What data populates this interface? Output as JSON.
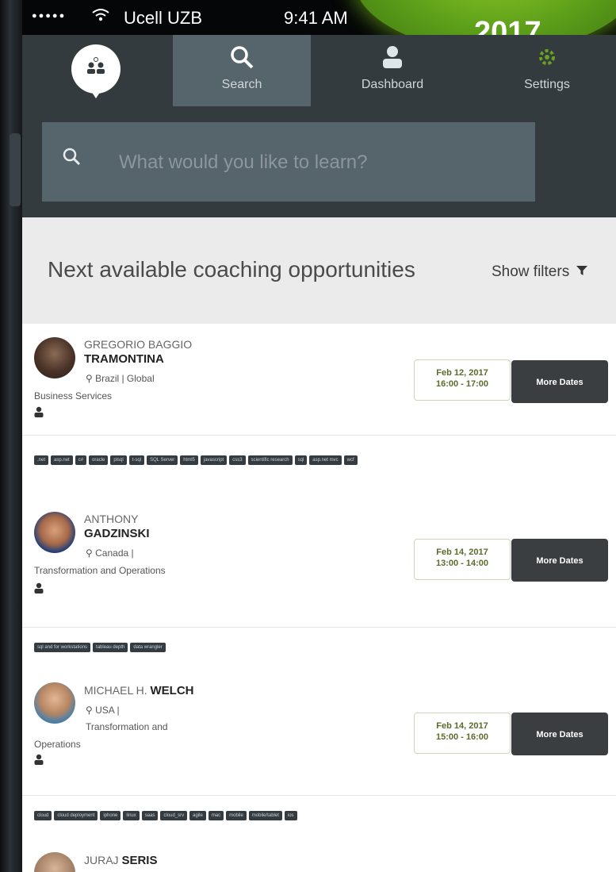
{
  "status_bar": {
    "signal": "●●●●●",
    "wifi_icon": "wifi-icon",
    "carrier": "Ucell UZB",
    "time": "9:41 AM"
  },
  "badge": {
    "text": "2017"
  },
  "nav": {
    "tabs": [
      {
        "label": "Search",
        "icon": "search-icon",
        "active": true
      },
      {
        "label": "Dashboard",
        "icon": "person-icon",
        "active": false
      },
      {
        "label": "Settings",
        "icon": "gear-icon",
        "active": false
      }
    ]
  },
  "search": {
    "placeholder": "What would you like to learn?"
  },
  "section": {
    "title": "Next available coaching opportunities",
    "filters_label": "Show filters"
  },
  "coaches": [
    {
      "first_name": "GREGORIO BAGGIO",
      "last_name": "TRAMONTINA",
      "location": "Brazil | Global",
      "role": "Business Services",
      "date": "Feb 12, 2017",
      "time": "16:00 - 17:00",
      "more_label": "More Dates",
      "tags": [
        ".net",
        "asp.net",
        "c#",
        "oracle",
        "plsql",
        "t-sql",
        "SQL Server",
        "html5",
        "javascript",
        "css3",
        "scientific research",
        "sql",
        "asp.net mvc",
        "wcf"
      ]
    },
    {
      "first_name": "ANTHONY",
      "last_name": "GADZINSKI",
      "location": "Canada |",
      "role": "Transformation and Operations",
      "date": "Feb 14, 2017",
      "time": "13:00 - 14:00",
      "more_label": "More Dates",
      "tags": [
        "sql and for workstations",
        "tableau depth",
        "data wrangler"
      ]
    },
    {
      "first_name": "MICHAEL H.",
      "last_name": "WELCH",
      "location": "USA |",
      "role_line1": "Transformation and",
      "role_line2": "Operations",
      "date": "Feb 14, 2017",
      "time": "15:00 - 16:00",
      "more_label": "More Dates",
      "tags": [
        "cloud",
        "cloud deployment",
        "iphone",
        "linux",
        "saas",
        "cloud_srv",
        "agile",
        "mac",
        "mobile",
        "mobile/tablet",
        "ios"
      ]
    },
    {
      "first_name": "JURAJ",
      "last_name": "SERIS"
    }
  ]
}
